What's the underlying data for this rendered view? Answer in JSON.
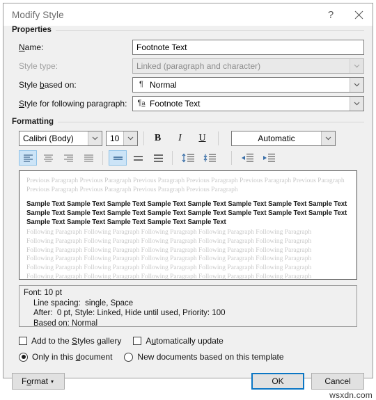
{
  "window": {
    "title": "Modify Style",
    "help_icon": "question-mark-icon",
    "close_icon": "close-icon"
  },
  "properties": {
    "group_label": "Properties",
    "name_label": "Name:",
    "name_value": "Footnote Text",
    "style_type_label": "Style type:",
    "style_type_value": "Linked (paragraph and character)",
    "style_based_on_label": "Style based on:",
    "style_based_on_value": "Normal",
    "style_based_on_icon": "¶",
    "style_following_label": "Style for following paragraph:",
    "style_following_value": "Footnote Text",
    "style_following_icon": "¶"
  },
  "formatting": {
    "group_label": "Formatting",
    "font_family": "Calibri (Body)",
    "font_size": "10",
    "bold_label": "B",
    "italic_label": "I",
    "underline_label": "U",
    "font_color": "Automatic",
    "align_buttons": [
      {
        "name": "align-left-button",
        "selected": true
      },
      {
        "name": "align-center-button",
        "selected": false
      },
      {
        "name": "align-right-button",
        "selected": false
      },
      {
        "name": "align-justify-button",
        "selected": false
      }
    ],
    "linespacing_buttons": [
      {
        "name": "line-spacing-single-button",
        "selected": true
      },
      {
        "name": "line-spacing-1-5-button",
        "selected": false
      },
      {
        "name": "line-spacing-double-button",
        "selected": false
      }
    ],
    "spacing_buttons": [
      {
        "name": "decrease-paragraph-spacing-button",
        "selected": false
      },
      {
        "name": "increase-paragraph-spacing-button",
        "selected": false
      }
    ],
    "indent_buttons": [
      {
        "name": "decrease-indent-button",
        "selected": false
      },
      {
        "name": "increase-indent-button",
        "selected": false
      }
    ]
  },
  "preview": {
    "previous_paragraph": "Previous Paragraph Previous Paragraph Previous Paragraph Previous Paragraph Previous Paragraph Previous Paragraph Previous Paragraph Previous Paragraph Previous Paragraph Previous Paragraph",
    "sample_text": "Sample Text Sample Text Sample Text Sample Text Sample Text Sample Text Sample Text Sample Text Sample Text Sample Text Sample Text Sample Text Sample Text Sample Text Sample Text Sample Text Sample Text Sample Text Sample Text Sample Text Sample Text",
    "following_paragraph_line": "Following Paragraph Following Paragraph Following Paragraph Following Paragraph Following Paragraph",
    "following_paragraph_lines": 6
  },
  "description": {
    "line1": "Font: 10 pt",
    "line2": "Line spacing:  single, Space",
    "line3": "After:  0 pt, Style: Linked, Hide until used, Priority: 100",
    "line4": "Based on: Normal"
  },
  "options": {
    "add_to_gallery_label": "Add to the Styles gallery",
    "add_to_gallery_checked": false,
    "auto_update_label": "Automatically update",
    "auto_update_checked": false,
    "only_this_document_label": "Only in this document",
    "only_this_document_selected": true,
    "new_documents_label": "New documents based on this template",
    "new_documents_selected": false
  },
  "footer": {
    "format_label": "Format",
    "format_caret": "▾",
    "ok_label": "OK",
    "cancel_label": "Cancel"
  },
  "watermark": "wsxdn.com",
  "colors": {
    "dialog_bg": "#f0f0f0",
    "accent_blue": "#0b76c4",
    "selected_tool": "#cce4f7",
    "icon_blue": "#3a6fa8"
  }
}
